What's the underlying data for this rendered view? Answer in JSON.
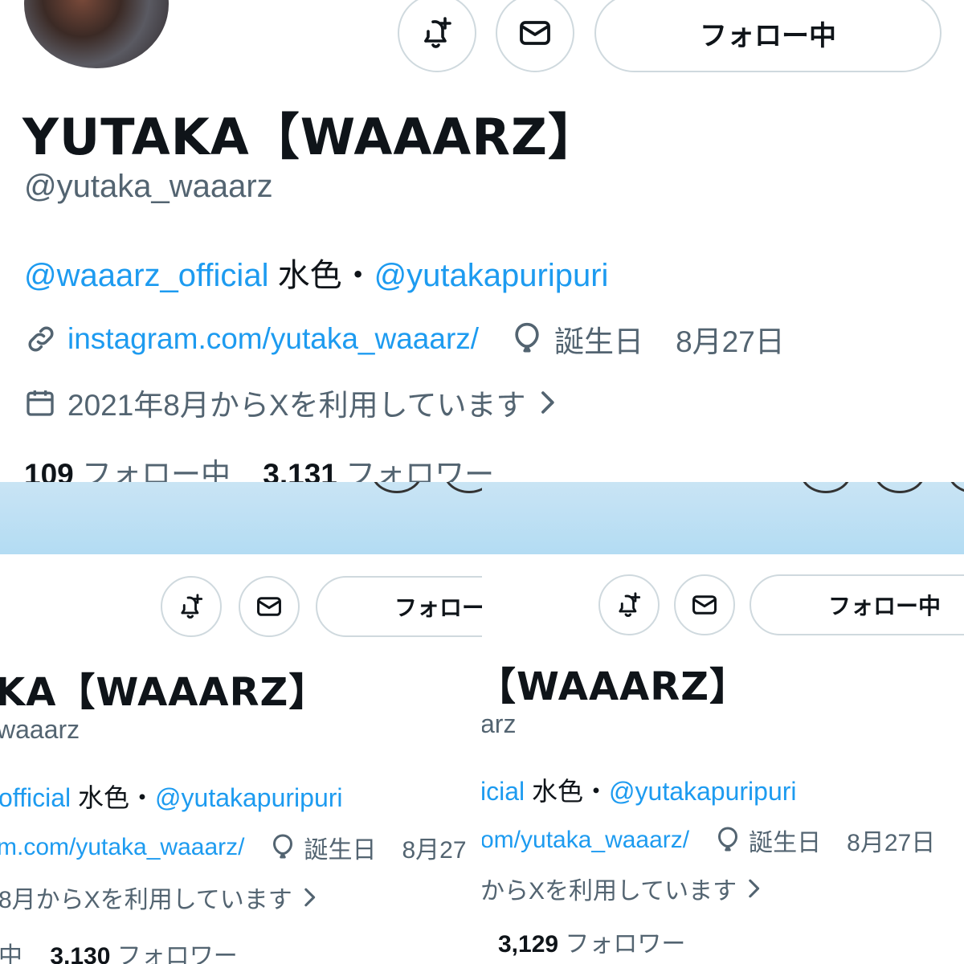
{
  "screens": [
    {
      "name": "YUTAKA【WAAARZ】",
      "handle": "@yutaka_waaarz",
      "bio": {
        "mention1": "@waaarz_official",
        "text": " 水色・",
        "mention2": "@yutakapuripuri"
      },
      "website": "instagram.com/yutaka_waaarz/",
      "birthday_label": "誕生日",
      "birthday": "8月27日",
      "joined": "2021年8月からXを利用しています",
      "following_count": "109",
      "following_label": "フォロー中",
      "followers_count": "3,131",
      "followers_label": "フォロワー",
      "follow_button": "フォロー中"
    },
    {
      "name": "KA【WAAARZ】",
      "handle": "waaarz",
      "bio": {
        "mention1": "official",
        "text": " 水色・",
        "mention2": "@yutakapuripuri"
      },
      "website": "m.com/yutaka_waaarz/",
      "birthday_label": "誕生日",
      "birthday": "8月27",
      "joined": "8月からXを利用しています",
      "following_label": "中",
      "followers_count": "3,130",
      "followers_label": "フォロワー",
      "follow_button": "フォロー"
    },
    {
      "name": "【WAAARZ】",
      "handle": "arz",
      "bio": {
        "mention1": "icial",
        "text": " 水色・",
        "mention2": "@yutakapuripuri"
      },
      "website": "om/yutaka_waaarz/",
      "birthday_label": "誕生日",
      "birthday": "8月27日",
      "joined": "からXを利用しています",
      "followers_count": "3,129",
      "followers_label": "フォロワー",
      "follow_button": "フォロー中"
    }
  ],
  "icons": {
    "notify": "bell-plus-icon",
    "message": "envelope-icon",
    "link": "link-icon",
    "birthday": "balloon-icon",
    "calendar": "calendar-icon",
    "chevron": "chevron-right-icon"
  },
  "colors": {
    "link": "#1d9bf0",
    "secondary": "#536471",
    "text": "#0f1419",
    "border": "#cfd9de",
    "banner": "#b3dcf3"
  }
}
